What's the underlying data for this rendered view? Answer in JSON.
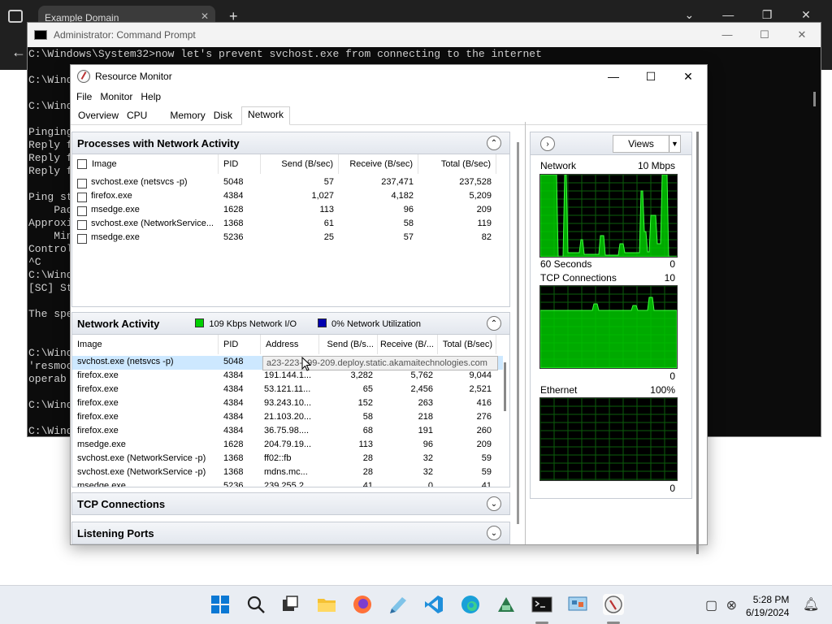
{
  "browser": {
    "tab_title": "Example Domain",
    "tab_close": "✕",
    "new_tab": "+",
    "back": "←",
    "ctrl_dropdown": "⌄",
    "ctrl_minimize": "—",
    "ctrl_restore": "❐",
    "ctrl_close": "✕"
  },
  "cmd": {
    "title": "Administrator: Command Prompt",
    "ctrl_minimize": "—",
    "ctrl_maximize": "☐",
    "ctrl_close": "✕",
    "lines": [
      "C:\\Windows\\System32>now let's prevent svchost.exe from connecting to the internet",
      "",
      "C:\\Wind",
      "",
      "C:\\Wind",
      "",
      "Pinging",
      "Reply f",
      "Reply f",
      "Reply f",
      "",
      "Ping st",
      "    Pac",
      "Approxi",
      "    Min",
      "Control",
      "^C",
      "C:\\Wind",
      "[SC] St",
      "",
      "The spe",
      "",
      "",
      "C:\\Wind",
      "'resmoo",
      "operab",
      "",
      "C:\\Wind",
      "",
      "C:\\Wind"
    ]
  },
  "resmon": {
    "title": "Resource Monitor",
    "ctrl_minimize": "—",
    "ctrl_maximize": "☐",
    "ctrl_close": "✕",
    "menu": [
      "File",
      "Monitor",
      "Help"
    ],
    "tabs": [
      "Overview",
      "CPU",
      "Memory",
      "Disk",
      "Network"
    ],
    "active_tab": "Network",
    "processes_panel": {
      "title": "Processes with Network Activity",
      "collapse_icon": "⌃",
      "columns": [
        "Image",
        "PID",
        "Send (B/sec)",
        "Receive (B/sec)",
        "Total (B/sec)"
      ],
      "rows": [
        {
          "image": "svchost.exe (netsvcs -p)",
          "pid": "5048",
          "send": "57",
          "receive": "237,471",
          "total": "237,528"
        },
        {
          "image": "firefox.exe",
          "pid": "4384",
          "send": "1,027",
          "receive": "4,182",
          "total": "5,209"
        },
        {
          "image": "msedge.exe",
          "pid": "1628",
          "send": "113",
          "receive": "96",
          "total": "209"
        },
        {
          "image": "svchost.exe (NetworkService...",
          "pid": "1368",
          "send": "61",
          "receive": "58",
          "total": "119"
        },
        {
          "image": "msedge.exe",
          "pid": "5236",
          "send": "25",
          "receive": "57",
          "total": "82"
        }
      ]
    },
    "network_activity_panel": {
      "title": "Network Activity",
      "legend_io": "109 Kbps Network I/O",
      "legend_util": "0% Network Utilization",
      "io_color": "#00d000",
      "util_color": "#0000b0",
      "collapse_icon": "⌃",
      "columns": [
        "Image",
        "PID",
        "Address",
        "Send (B/s...",
        "Receive (B/...",
        "Total (B/sec)"
      ],
      "rows": [
        {
          "image": "svchost.exe (netsvcs -p)",
          "pid": "5048",
          "address": "",
          "send": "",
          "receive": "",
          "total": ""
        },
        {
          "image": "firefox.exe",
          "pid": "4384",
          "address": "191.144.1...",
          "send": "3,282",
          "receive": "5,762",
          "total": "9,044"
        },
        {
          "image": "firefox.exe",
          "pid": "4384",
          "address": "53.121.11...",
          "send": "65",
          "receive": "2,456",
          "total": "2,521"
        },
        {
          "image": "firefox.exe",
          "pid": "4384",
          "address": "93.243.10...",
          "send": "152",
          "receive": "263",
          "total": "416"
        },
        {
          "image": "firefox.exe",
          "pid": "4384",
          "address": "21.103.20...",
          "send": "58",
          "receive": "218",
          "total": "276"
        },
        {
          "image": "firefox.exe",
          "pid": "4384",
          "address": "36.75.98....",
          "send": "68",
          "receive": "191",
          "total": "260"
        },
        {
          "image": "msedge.exe",
          "pid": "1628",
          "address": "204.79.19...",
          "send": "113",
          "receive": "96",
          "total": "209"
        },
        {
          "image": "svchost.exe (NetworkService -p)",
          "pid": "1368",
          "address": "ff02::fb",
          "send": "28",
          "receive": "32",
          "total": "59"
        },
        {
          "image": "svchost.exe (NetworkService -p)",
          "pid": "1368",
          "address": "mdns.mc...",
          "send": "28",
          "receive": "32",
          "total": "59"
        },
        {
          "image": "msedge.exe",
          "pid": "5236",
          "address": "239.255.2...",
          "send": "41",
          "receive": "0",
          "total": "41"
        }
      ],
      "tooltip": "a23-223-199-209.deploy.static.akamaitechnologies.com"
    },
    "tcp_panel": {
      "title": "TCP Connections",
      "expand_icon": "⌄"
    },
    "listening_panel": {
      "title": "Listening Ports",
      "expand_icon": "⌄"
    },
    "right_pane": {
      "expand_icon": "›",
      "views_label": "Views",
      "views_dropdown": "▼",
      "graphs": [
        {
          "title": "Network",
          "max": "10 Mbps",
          "footer_left": "60 Seconds",
          "footer_right": "0"
        },
        {
          "title": "TCP Connections",
          "max": "10",
          "footer_left": "",
          "footer_right": "0"
        },
        {
          "title": "Ethernet",
          "max": "100%",
          "footer_left": "",
          "footer_right": "0"
        }
      ],
      "graph_color": "#00c800"
    }
  },
  "taskbar": {
    "time": "5:28 PM",
    "date": "6/19/2024",
    "apps": [
      "start-icon",
      "search-icon",
      "task-view-icon",
      "file-explorer-icon",
      "firefox-icon",
      "notepad-icon",
      "vscode-icon",
      "edge-icon",
      "app-icon",
      "terminal-icon",
      "control-panel-icon",
      "resource-monitor-icon"
    ]
  }
}
